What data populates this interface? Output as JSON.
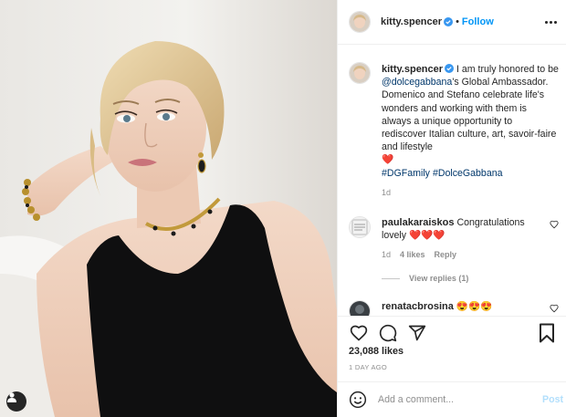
{
  "header": {
    "username": "kitty.spencer",
    "separator": "•",
    "follow_label": "Follow"
  },
  "caption": {
    "username": "kitty.spencer",
    "text_before": " I am truly honored to be ",
    "mention": "@dolcegabbana",
    "text_after": "'s Global Ambassador. Domenico and Stefano celebrate life's wonders and working with them is always a unique opportunity to rediscover Italian culture, art, savoir-faire and lifestyle",
    "emoji": "❤️",
    "hashtag_1": "#DGFamily",
    "hashtag_2": "#DolceGabbana",
    "time": "1d"
  },
  "comments": [
    {
      "username": "paulakaraiskos",
      "text": " Congratulations lovely ",
      "emoji": "❤️❤️❤️",
      "time": "1d",
      "likes": "4 likes",
      "reply": "Reply"
    },
    {
      "username": "renatacbrosina",
      "emoji": "😍😍😍"
    }
  ],
  "view_replies": "View replies (1)",
  "likes": "23,088 likes",
  "posted_ago": "1 DAY AGO",
  "add_comment": {
    "placeholder": "Add a comment...",
    "post_label": "Post"
  },
  "colors": {
    "link": "#00376b",
    "follow": "#0095f6",
    "verified": "#3897f0",
    "heart": "#ed4956"
  },
  "icons": [
    "user-tag-icon",
    "verified-icon",
    "more-options-icon",
    "heart-icon",
    "comment-icon",
    "share-icon",
    "bookmark-icon",
    "emoji-icon"
  ]
}
